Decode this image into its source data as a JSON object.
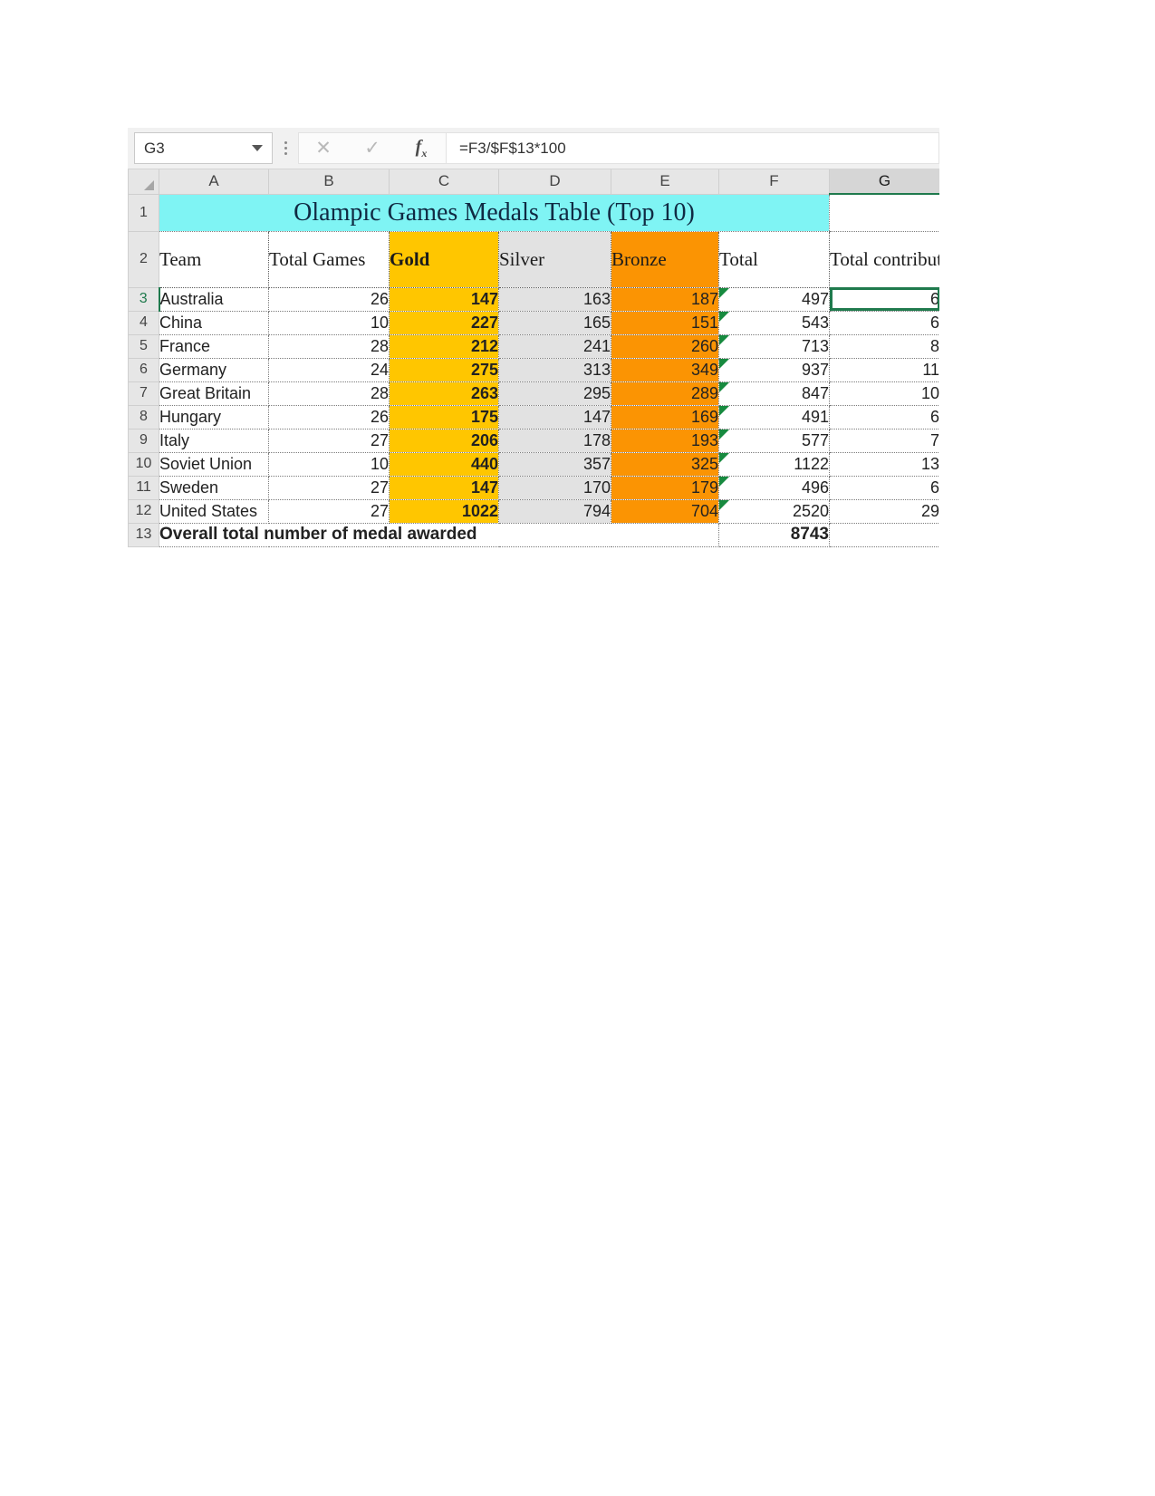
{
  "app": {
    "kind": "spreadsheet"
  },
  "formula_bar": {
    "name_box_value": "G3",
    "name_box_dropdown_icon": "chevron-down-icon",
    "more_options_icon": "kebab-menu-icon",
    "cancel_icon": "close-icon",
    "confirm_icon": "check-icon",
    "function_icon": "fx-icon",
    "function_icon_label": "fx",
    "formula_value": "=F3/$F$13*100"
  },
  "grid": {
    "corner_icon": "select-all-triangle-icon",
    "column_headers": [
      "A",
      "B",
      "C",
      "D",
      "E",
      "F",
      "G"
    ],
    "active_column": "G",
    "active_row": "3",
    "row_headers": [
      "1",
      "2",
      "3",
      "4",
      "5",
      "6",
      "7",
      "8",
      "9",
      "10",
      "11",
      "12",
      "13"
    ],
    "title": {
      "text": "Olampic Games Medals Table (Top 10)",
      "fill": "#7ff4f4",
      "span_columns": [
        "A",
        "B",
        "C",
        "D",
        "E",
        "F"
      ]
    },
    "headers": [
      {
        "label": "Team",
        "column": "A",
        "fill": "#ffffff"
      },
      {
        "label": "Total Games",
        "column": "B",
        "fill": "#ffffff"
      },
      {
        "label": "Gold",
        "column": "C",
        "fill": "#ffc600",
        "bold": true
      },
      {
        "label": "Silver",
        "column": "D",
        "fill": "#e2e2e2"
      },
      {
        "label": "Bronze",
        "column": "E",
        "fill": "#fb9403"
      },
      {
        "label": "Total",
        "column": "F",
        "fill": "#ffffff"
      },
      {
        "label": "Total contribution",
        "column": "G",
        "fill": "#ffffff"
      }
    ],
    "rows": [
      {
        "row": "3",
        "team": "Australia",
        "total_games": "26",
        "gold": "147",
        "silver": "163",
        "bronze": "187",
        "total": "497",
        "contribution": "6"
      },
      {
        "row": "4",
        "team": "China",
        "total_games": "10",
        "gold": "227",
        "silver": "165",
        "bronze": "151",
        "total": "543",
        "contribution": "6"
      },
      {
        "row": "5",
        "team": "France",
        "total_games": "28",
        "gold": "212",
        "silver": "241",
        "bronze": "260",
        "total": "713",
        "contribution": "8"
      },
      {
        "row": "6",
        "team": "Germany",
        "total_games": "24",
        "gold": "275",
        "silver": "313",
        "bronze": "349",
        "total": "937",
        "contribution": "11"
      },
      {
        "row": "7",
        "team": "Great Britain",
        "total_games": "28",
        "gold": "263",
        "silver": "295",
        "bronze": "289",
        "total": "847",
        "contribution": "10"
      },
      {
        "row": "8",
        "team": "Hungary",
        "total_games": "26",
        "gold": "175",
        "silver": "147",
        "bronze": "169",
        "total": "491",
        "contribution": "6"
      },
      {
        "row": "9",
        "team": "Italy",
        "total_games": "27",
        "gold": "206",
        "silver": "178",
        "bronze": "193",
        "total": "577",
        "contribution": "7"
      },
      {
        "row": "10",
        "team": "Soviet Union",
        "total_games": "10",
        "gold": "440",
        "silver": "357",
        "bronze": "325",
        "total": "1122",
        "contribution": "13"
      },
      {
        "row": "11",
        "team": "Sweden",
        "total_games": "27",
        "gold": "147",
        "silver": "170",
        "bronze": "179",
        "total": "496",
        "contribution": "6"
      },
      {
        "row": "12",
        "team": "United States",
        "total_games": "27",
        "gold": "1022",
        "silver": "794",
        "bronze": "704",
        "total": "2520",
        "contribution": "29"
      }
    ],
    "footer": {
      "row": "13",
      "label": "Overall total number of medal awarded",
      "total": "8743"
    }
  },
  "chart_data": {
    "type": "table",
    "title": "Olampic Games Medals Table (Top 10)",
    "columns": [
      "Team",
      "Total Games",
      "Gold",
      "Silver",
      "Bronze",
      "Total",
      "Total contribution"
    ],
    "rows": [
      [
        "Australia",
        26,
        147,
        163,
        187,
        497,
        6
      ],
      [
        "China",
        10,
        227,
        165,
        151,
        543,
        6
      ],
      [
        "France",
        28,
        212,
        241,
        260,
        713,
        8
      ],
      [
        "Germany",
        24,
        275,
        313,
        349,
        937,
        11
      ],
      [
        "Great Britain",
        28,
        263,
        295,
        289,
        847,
        10
      ],
      [
        "Hungary",
        26,
        175,
        147,
        169,
        491,
        6
      ],
      [
        "Italy",
        27,
        206,
        178,
        193,
        577,
        7
      ],
      [
        "Soviet Union",
        10,
        440,
        357,
        325,
        1122,
        13
      ],
      [
        "Sweden",
        27,
        147,
        170,
        179,
        496,
        6
      ],
      [
        "United States",
        27,
        1022,
        794,
        704,
        2520,
        29
      ]
    ],
    "footer_label": "Overall total number of medal awarded",
    "footer_total": 8743
  }
}
